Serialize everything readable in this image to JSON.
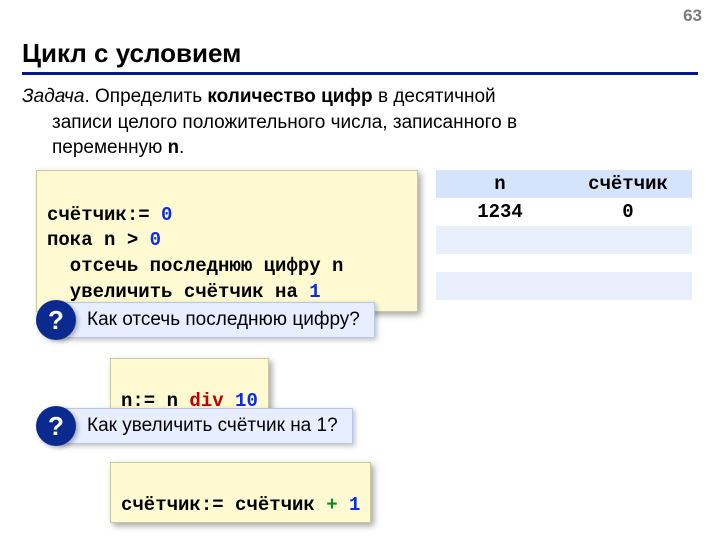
{
  "page_number": "63",
  "title": "Цикл с условием",
  "task": {
    "label_italic": "Задача",
    "dot": ". ",
    "pre_bold": "Определить ",
    "bold": "количество цифр",
    "after_bold": " в десятичной",
    "line2a": "записи целого положительного числа, записанного в",
    "line3a": "переменную ",
    "var": "n",
    "line3b": "."
  },
  "code_main": {
    "l1_a": "счётчик:= ",
    "l1_b": "0",
    "l2_a": "пока n > ",
    "l2_b": "0",
    "l3": "  отсечь последнюю цифру n",
    "l4_a": "  увеличить счётчик на ",
    "l4_b": "1"
  },
  "hint1": {
    "q": "?",
    "text": "Как отсечь последнюю цифру?"
  },
  "code_div": {
    "a": "n:= n ",
    "kw": "div",
    "sp": " ",
    "num": "10"
  },
  "hint2": {
    "q": "?",
    "text": "Как увеличить счётчик на 1?"
  },
  "code_inc": {
    "a": "счётчик:= счётчик ",
    "plus": "+",
    "sp": " ",
    "num": "1"
  },
  "trace": {
    "headers": [
      "n",
      "счётчик"
    ],
    "rows": [
      [
        "1234",
        "0"
      ],
      [
        "",
        ""
      ],
      [
        "",
        ""
      ]
    ]
  }
}
